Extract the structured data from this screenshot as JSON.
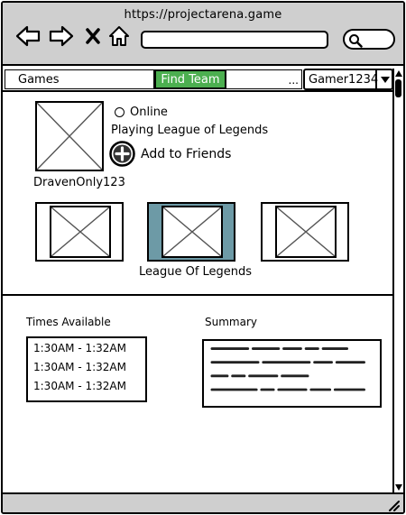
{
  "browser": {
    "url": "https://projectarena.game",
    "icons": [
      "back-arrow-icon",
      "forward-arrow-icon",
      "close-icon",
      "home-icon",
      "search-icon"
    ]
  },
  "tabs": {
    "games": "Games",
    "find_team": "Find Team",
    "overflow": "...",
    "user_select": "Gamer1234"
  },
  "profile": {
    "status": "Online",
    "activity": "Playing League of Legends",
    "add_friends": "Add to Friends",
    "username": "DravenOnly123"
  },
  "games": {
    "selected_label": "League Of Legends"
  },
  "availability": {
    "label": "Times Available",
    "times": [
      "1:30AM - 1:32AM",
      "1:30AM - 1:32AM",
      "1:30AM - 1:32AM"
    ]
  },
  "summary": {
    "label": "Summary"
  },
  "colors": {
    "chrome": "#cfcfcf",
    "accent": "#4caf50",
    "selected_card": "#6d9aa6"
  }
}
